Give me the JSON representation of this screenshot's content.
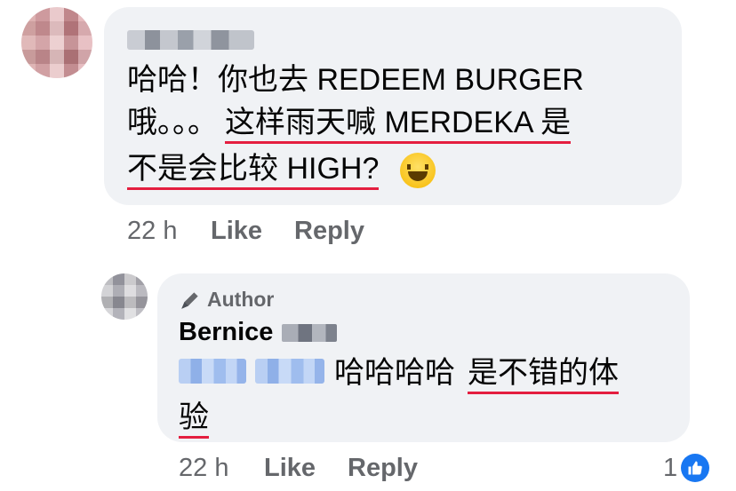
{
  "comment1": {
    "line1": "哈哈！你也去 REDEEM BURGER",
    "line2_plain": "哦。。。",
    "line2_underlined": "这样雨天喊 MERDEKA 是",
    "line3_underlined": "不是会比较 HIGH?",
    "emoji": "laughing-face",
    "time": "22 h",
    "like_label": "Like",
    "reply_label": "Reply"
  },
  "reply1": {
    "badge_label": "Author",
    "author_name": "Bernice",
    "text_plain": "哈哈哈哈",
    "text_underlined_line1": "是不错的体",
    "text_underlined_line2": "验",
    "time": "22 h",
    "like_label": "Like",
    "reply_label": "Reply",
    "reaction_count": "1"
  },
  "colors": {
    "bubble": "#f0f2f5",
    "underline": "#e41e3f",
    "meta": "#65676b",
    "like_blue": "#1877f2"
  }
}
